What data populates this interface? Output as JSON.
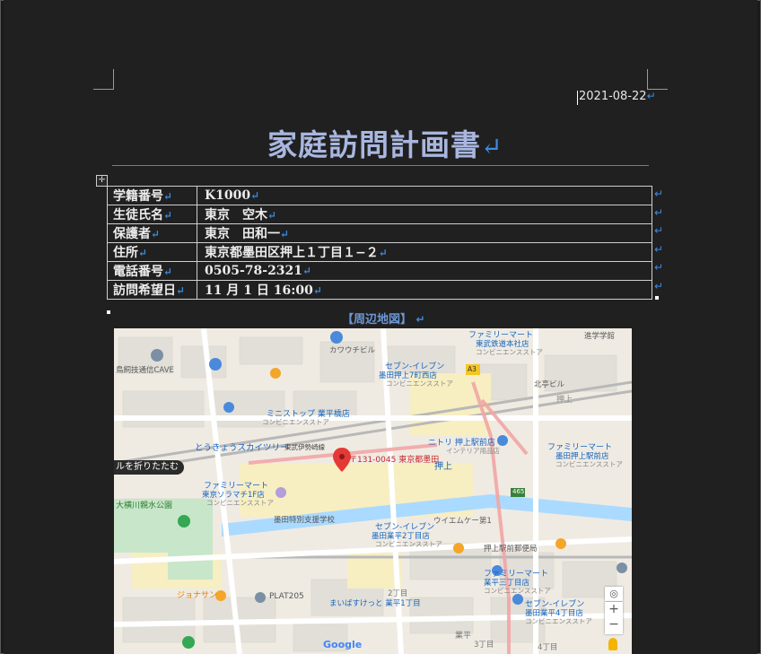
{
  "document": {
    "date": "2021-08-22",
    "title": "家庭訪問計画書",
    "paragraph_mark": "↵",
    "table": [
      {
        "key": "学籍番号",
        "value": "K1000"
      },
      {
        "key": "生徒氏名",
        "value": "東京　空木"
      },
      {
        "key": "保護者",
        "value": "東京　田和一"
      },
      {
        "key": "住所",
        "value": "東京都墨田区押上１丁目１−２"
      },
      {
        "key": "電話番号",
        "value": "0505-78-2321"
      },
      {
        "key": "訪問希望日",
        "value": "11 月 1 日 16:00"
      }
    ],
    "map_heading": "【周辺地図】"
  },
  "map": {
    "pin_label": "〒131-0045 東京都墨田",
    "collapse_tab": "ルを折りたたむ",
    "google": "Google",
    "labels": {
      "cave": "鳥飼技通信CAVE",
      "kawauchi": "カワウチビル",
      "famima_top": "ファミリーマート",
      "famima_top_sub": "東武鉄道本社店",
      "famima_top_type": "コンビニエンスストア",
      "seven_top": "セブン-イレブン",
      "seven_top_sub": "墨田押上7町西店",
      "seven_top_type": "コンビニエンスストア",
      "ministop": "ミニストップ 業平橋店",
      "ministop_type": "コンビニエンスストア",
      "skytree_station": "とうきょうスカイツリー",
      "tobu_line": "東武伊勢崎線",
      "nitori": "ニトリ 押上駅前店",
      "nitori_type": "インテリア用品店",
      "oshiage": "押上",
      "oshiage_st": "押上",
      "famima_right": "ファミリーマート",
      "famima_right_sub": "墨田押上駅前店",
      "famima_right_type": "コンビニエンスストア",
      "famima_left": "ファミリーマート",
      "famima_left_sub": "東京ソラマチ1F店",
      "famima_left_type": "コンビニエンスストア",
      "park": "大横川親水公園",
      "sumida_hs": "墨田特別支援学校",
      "seven_mid": "セブン-イレブン",
      "seven_mid_sub": "墨田業平2丁目店",
      "seven_mid_type": "コンビニエンスストア",
      "wakeup": "ウイエムケー第1",
      "oshiage_post": "押上駅前郵便局",
      "famima_bottom": "ファミリーマート",
      "famima_bottom_sub": "業平三丁目店",
      "famima_bottom_type": "コンビニエンスストア",
      "plat": "PLAT205",
      "mabashi": "まいばすけっと 業平1丁目",
      "jonasan": "ジョナサン",
      "seven_bot": "セブン-イレブン",
      "seven_bot_sub": "墨田業平4丁目店",
      "seven_bot_type": "コンビニエンスストア",
      "narihira": "業平",
      "chome2": "2丁目",
      "chome3": "3丁目",
      "chome4": "4丁目",
      "a3": "A3",
      "r465": "465",
      "shinkiba": "進学学館",
      "kitakyo": "北亭ビル"
    }
  }
}
